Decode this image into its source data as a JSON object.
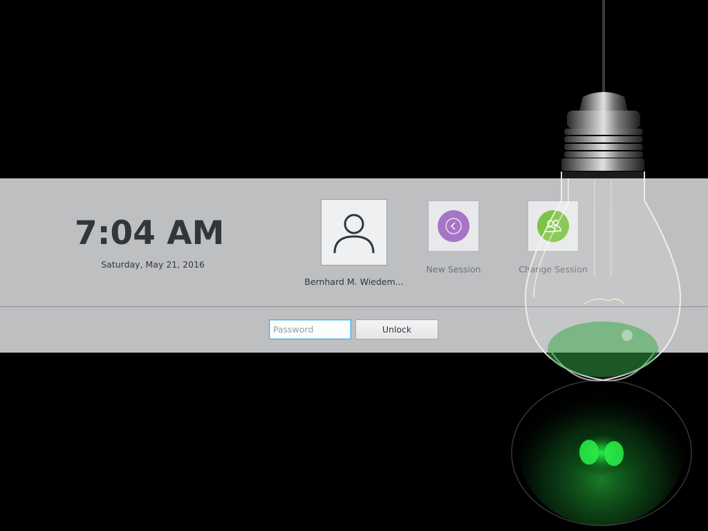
{
  "clock": {
    "time": "7:04 AM",
    "date": "Saturday, May 21, 2016"
  },
  "user": {
    "name": "Bernhard M. Wiedem...",
    "avatar_icon": "user-icon"
  },
  "actions": [
    {
      "label": "New Session",
      "icon": "back-arrow-icon",
      "color": "#a874c6"
    },
    {
      "label": "Change Session",
      "icon": "users-icon",
      "color": "#7cc443"
    }
  ],
  "login": {
    "password_placeholder": "Password",
    "unlock_label": "Unlock"
  },
  "theme": {
    "accent": "#3daee9",
    "text": "#31363b",
    "panel": "#d8dadc",
    "glow": "#22d43a"
  }
}
